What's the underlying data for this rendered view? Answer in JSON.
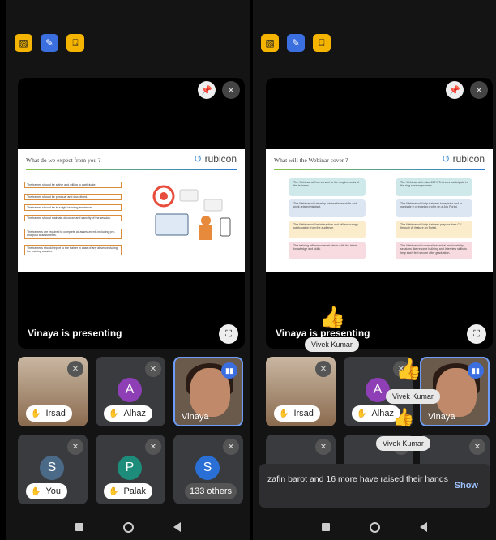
{
  "left": {
    "slide": {
      "title": "What do we expect from you ?",
      "logo_prefix": "r",
      "logo_text": "ubicon",
      "items": [
        "The trainee should be active and willing to participate.",
        "The trainee should be punctual and disciplined.",
        "The trainee should be in a right learning ambience.",
        "The trainee should maintain decorum and sanctity of the session.",
        "The trainees are required to complete all assessments including pre- and post assessments.",
        "The trainees should report to the trainer in case of any absence during the training session."
      ]
    },
    "presenting_label": "Vinaya is presenting",
    "tiles": [
      {
        "name": "Irsad",
        "type": "photo"
      },
      {
        "name": "Alhaz",
        "initial": "A",
        "color": "#8e3fb5"
      },
      {
        "name": "Vinaya",
        "type": "speaking"
      },
      {
        "name": "You",
        "initial": "S",
        "color": "#4a6a88"
      },
      {
        "name": "Palak",
        "initial": "P",
        "color": "#1d8c7a"
      },
      {
        "name": "133 others",
        "initial": "S",
        "color": "#2a6fd6"
      }
    ]
  },
  "right": {
    "slide": {
      "title": "What will the Webinar cover ?",
      "logo_prefix": "r",
      "logo_text": "ubicon",
      "left_items": [
        "The Webinar will be relevant to the requirements of the trainees.",
        "The Webinar will develop job readiness skills and work related mindset.",
        "The Webinar will be interactive and will encourage participation from the audience.",
        "The training will empower students with the latest knowledge and skills."
      ],
      "right_items": [
        "The Webinar will make 100% Trainees participate in the ring session process.",
        "The Webinar will help trainees to register and to navigate in preparing profile on a Job Portal.",
        "The Webinar will help trainees prepare their CV through AI feature on Portal.",
        "The Webinar will cover all essential employability sessions like resume building and Interview skills to help each feel secure after graduation."
      ]
    },
    "presenting_label": "Vinaya is presenting",
    "reactions": [
      "Vivek Kumar",
      "Vivek Kumar",
      "Vivek Kumar"
    ],
    "tiles": [
      {
        "name": "Irsad"
      },
      {
        "name": "Alhaz",
        "initial": "A"
      },
      {
        "name": "Vinaya"
      }
    ],
    "toast": {
      "message": "zafin barot and 16 more have raised their hands",
      "action": "Show"
    }
  }
}
